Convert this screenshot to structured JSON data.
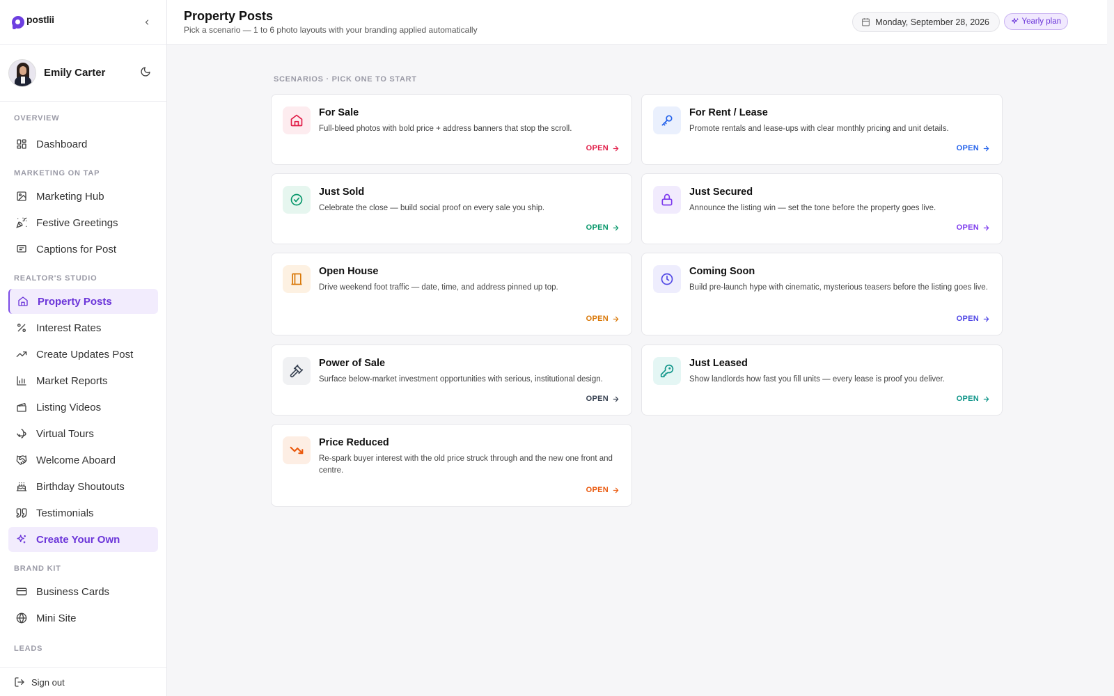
{
  "brand": {
    "name": "postlii"
  },
  "profile": {
    "name": "Emily Carter"
  },
  "nav": {
    "sections": {
      "overview": "OVERVIEW",
      "marketing": "MARKETING ON TAP",
      "studio": "REALTOR'S STUDIO",
      "brand_kit": "BRAND KIT",
      "leads": "LEADS"
    },
    "items": {
      "dashboard": "Dashboard",
      "marketing_hub": "Marketing Hub",
      "festive_greetings": "Festive Greetings",
      "captions": "Captions for Post",
      "property_posts": "Property Posts",
      "interest_rates": "Interest Rates",
      "create_updates": "Create Updates Post",
      "market_reports": "Market Reports",
      "listing_videos": "Listing Videos",
      "virtual_tours": "Virtual Tours",
      "welcome_aboard": "Welcome Aboard",
      "birthday_shoutouts": "Birthday Shoutouts",
      "testimonials": "Testimonials",
      "create_your_own": "Create Your Own",
      "business_cards": "Business Cards",
      "mini_site": "Mini Site"
    },
    "signout": "Sign out"
  },
  "header": {
    "title": "Property Posts",
    "subtitle": "Pick a scenario — 1 to 6 photo layouts with your branding applied automatically",
    "date": "Monday, September 28, 2026",
    "plan": "Yearly plan"
  },
  "main": {
    "section_label": "SCENARIOS · PICK ONE TO START",
    "open_label": "OPEN",
    "cards": [
      {
        "title": "For Sale",
        "desc": "Full-bleed photos with bold price + address banners that stop the scroll.",
        "color": "#e11d48",
        "bg": "#fdecef",
        "icon": "house-icon"
      },
      {
        "title": "For Rent / Lease",
        "desc": "Promote rentals and lease-ups with clear monthly pricing and unit details.",
        "color": "#2563eb",
        "bg": "#eaf0fd",
        "icon": "key-icon"
      },
      {
        "title": "Just Sold",
        "desc": "Celebrate the close — build social proof on every sale you ship.",
        "color": "#059669",
        "bg": "#e6f6ef",
        "icon": "check-circle-icon"
      },
      {
        "title": "Just Secured",
        "desc": "Announce the listing win — set the tone before the property goes live.",
        "color": "#7c3aed",
        "bg": "#f1ebfd",
        "icon": "lock-icon"
      },
      {
        "title": "Open House",
        "desc": "Drive weekend foot traffic — date, time, and address pinned up top.",
        "color": "#d97706",
        "bg": "#fdf1e2",
        "icon": "door-icon"
      },
      {
        "title": "Coming Soon",
        "desc": "Build pre-launch hype with cinematic, mysterious teasers before the listing goes live.",
        "color": "#4f46e5",
        "bg": "#eeedfd",
        "icon": "clock-icon"
      },
      {
        "title": "Power of Sale",
        "desc": "Surface below-market investment opportunities with serious, institutional design.",
        "color": "#374151",
        "bg": "#f0f1f3",
        "icon": "gavel-icon"
      },
      {
        "title": "Just Leased",
        "desc": "Show landlords how fast you fill units — every lease is proof you deliver.",
        "color": "#0d9488",
        "bg": "#e4f6f4",
        "icon": "key-round-icon"
      },
      {
        "title": "Price Reduced",
        "desc": "Re-spark buyer interest with the old price struck through and the new one front and centre.",
        "color": "#ea580c",
        "bg": "#fdeee4",
        "icon": "trending-down-icon"
      }
    ]
  }
}
